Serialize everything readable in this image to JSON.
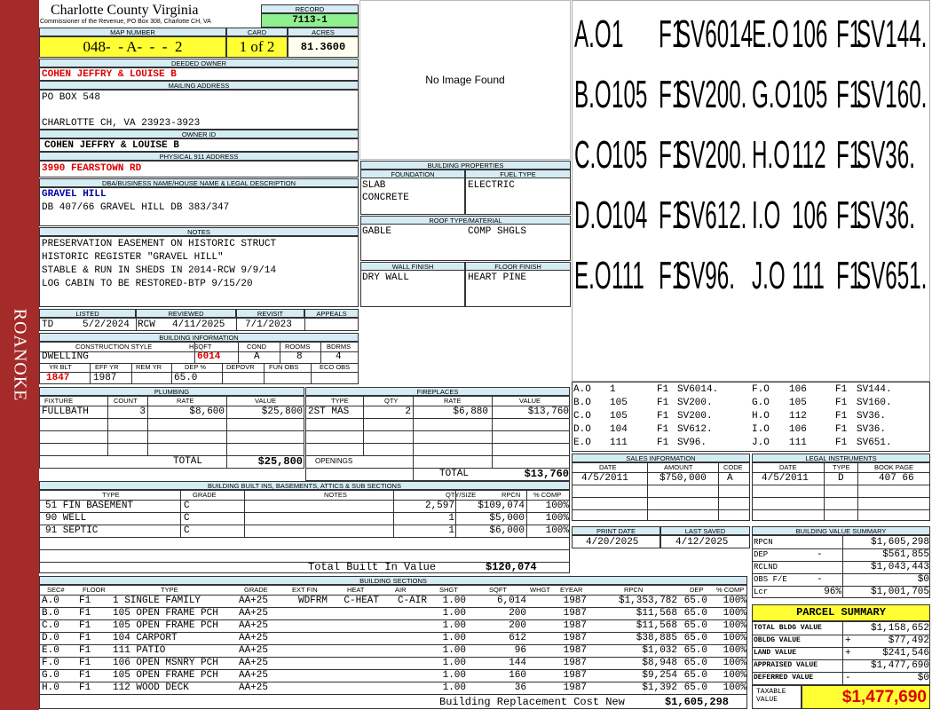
{
  "side_label": "ROANOKE",
  "county": {
    "title": "Charlotte County Virginia",
    "subtitle": "Commissioner of the Revenue, PO Box 308, Charlotte CH, VA"
  },
  "record": {
    "label": "RECORD",
    "value": "7113-1"
  },
  "map": {
    "label": "MAP NUMBER",
    "value": "048-  - A-  -  -  2"
  },
  "card": {
    "label": "CARD",
    "value": "1 of 2"
  },
  "acres": {
    "label": "ACRES",
    "value": "81.3600"
  },
  "deeded_owner": {
    "label": "DEEDED OWNER",
    "value": "COHEN JEFFRY & LOUISE B"
  },
  "mailing": {
    "label": "MAILING ADDRESS",
    "line1": "PO BOX 548",
    "line2": "CHARLOTTE CH, VA 23923-3923"
  },
  "owner_id": {
    "label": "OWNER ID",
    "value": "COHEN JEFFRY & LOUISE B"
  },
  "physical": {
    "label": "PHYSICAL 911 ADDRESS",
    "value": "3990 FEARSTOWN RD"
  },
  "dba": {
    "label": "DBA/BUSINESS NAME/HOUSE NAME & LEGAL DESCRIPTION",
    "name": "GRAVEL HILL",
    "desc": "DB 407/66 GRAVEL HILL DB 383/347"
  },
  "notes": {
    "label": "NOTES",
    "lines": [
      "PRESERVATION EASEMENT ON HISTORIC STRUCT",
      "HISTORIC REGISTER \"GRAVEL HILL\"",
      "STABLE & RUN IN SHEDS IN 2014-RCW 9/9/14",
      "LOG CABIN TO BE RESTORED-BTP 9/15/20"
    ]
  },
  "image": {
    "text": "No Image Found"
  },
  "building_props": {
    "label": "BUILDING PROPERTIES",
    "foundation_label": "FOUNDATION",
    "foundation": [
      "SLAB",
      "CONCRETE"
    ],
    "fuel_label": "FUEL TYPE",
    "fuel": "ELECTRIC",
    "roof_label": "ROOF TYPE/MATERIAL",
    "roof_type": "GABLE",
    "roof_material": "COMP SHGLS",
    "wall_label": "WALL FINISH",
    "wall": "DRY WALL",
    "floor_label": "FLOOR FINISH",
    "floor": "HEART PINE"
  },
  "listed": {
    "label": "LISTED",
    "by": "TD",
    "date": "5/2/2024"
  },
  "reviewed": {
    "label": "REVIEWED",
    "by": "RCW",
    "date": "4/11/2025"
  },
  "revisit": {
    "label": "REVISIT",
    "date": "7/1/2023"
  },
  "appeals": {
    "label": "APPEALS"
  },
  "building_info": {
    "label": "BUILDING INFORMATION",
    "style_label": "CONSTRUCTION STYLE",
    "style": "DWELLING",
    "hsqft_label": "HSQFT",
    "hsqft": "6014",
    "cond_label": "COND",
    "cond": "A",
    "rooms_label": "ROOMS",
    "rooms": "8",
    "bdrms_label": "BDRMS",
    "bdrms": "4",
    "yrblt_label": "YR BLT",
    "yrblt": "1847",
    "effyr_label": "EFF YR",
    "effyr": "1987",
    "remyr_label": "REM YR",
    "dep_label": "DEP %",
    "dep": "65.0",
    "depovr_label": "DEPOVR",
    "funobs_label": "FUN OBS",
    "ecoobs_label": "ECO OBS"
  },
  "plumbing": {
    "label": "PLUMBING",
    "headers": [
      "FIXTURE",
      "COUNT",
      "RATE",
      "VALUE"
    ],
    "rows": [
      [
        "FULLBATH",
        "3",
        "$8,600",
        "$25,800"
      ]
    ],
    "total_label": "TOTAL",
    "total": "$25,800"
  },
  "fireplaces": {
    "label": "FIREPLACES",
    "headers": [
      "TYPE",
      "QTY",
      "RATE",
      "VALUE"
    ],
    "rows": [
      [
        "2ST MAS",
        "2",
        "$6,880",
        "$13,760"
      ]
    ],
    "openings_label": "OPENINGS",
    "total_label": "TOTAL",
    "total": "$13,760"
  },
  "sketch": {
    "big": [
      [
        "A.O",
        "1",
        "F1",
        "SV6014.",
        "E.O",
        "106",
        "F1",
        "SV144."
      ],
      [
        "B.O",
        "105",
        "F1",
        "SV200.",
        "G.O",
        "105",
        "F1",
        "SV160."
      ],
      [
        "C.O",
        "105",
        "F1",
        "SV200.",
        "H.O",
        "112",
        "F1",
        "SV36."
      ],
      [
        "D.O",
        "104",
        "F1",
        "SV612.",
        "I.O",
        "106",
        "F1",
        "SV36."
      ],
      [
        "E.O",
        "111",
        "F1",
        "SV96.",
        "J.O",
        "111",
        "F1",
        "SV651."
      ]
    ],
    "small": [
      [
        "A.O",
        "1",
        "F1",
        "SV6014.",
        "F.O",
        "106",
        "F1",
        "SV144."
      ],
      [
        "B.O",
        "105",
        "F1",
        "SV200.",
        "G.O",
        "105",
        "F1",
        "SV160."
      ],
      [
        "C.O",
        "105",
        "F1",
        "SV200.",
        "H.O",
        "112",
        "F1",
        "SV36."
      ],
      [
        "D.O",
        "104",
        "F1",
        "SV612.",
        "I.O",
        "106",
        "F1",
        "SV36."
      ],
      [
        "E.O",
        "111",
        "F1",
        "SV96.",
        "J.O",
        "111",
        "F1",
        "SV651."
      ]
    ]
  },
  "sales": {
    "label": "SALES INFORMATION",
    "headers": [
      "DATE",
      "AMOUNT",
      "CODE"
    ],
    "rows": [
      [
        "4/5/2011",
        "$750,000",
        "A"
      ]
    ]
  },
  "legal": {
    "label": "LEGAL INSTRUMENTS",
    "headers": [
      "DATE",
      "TYPE",
      "BOOK PAGE"
    ],
    "rows": [
      [
        "4/5/2011",
        "D",
        "407 66"
      ]
    ]
  },
  "print_date": {
    "label": "PRINT DATE",
    "value": "4/20/2025"
  },
  "last_saved": {
    "label": "LAST SAVED",
    "value": "4/12/2025"
  },
  "builtins": {
    "label": "BUILDING BUILT INS, BASEMENTS, ATTICS & SUB SECTIONS",
    "headers": [
      "TYPE",
      "GRADE",
      "NOTES",
      "QTY/SIZE",
      "RPCN",
      "% COMP"
    ],
    "rows": [
      [
        "51 FIN BASEMENT",
        "C",
        "",
        "2,597",
        "$109,074",
        "100%"
      ],
      [
        "90 WELL",
        "C",
        "",
        "1",
        "$5,000",
        "100%"
      ],
      [
        "91 SEPTIC",
        "C",
        "",
        "1",
        "$6,000",
        "100%"
      ]
    ],
    "total_label": "Total Built In Value",
    "total": "$120,074"
  },
  "value_summary": {
    "label": "BUILDING VALUE SUMMARY",
    "rows": [
      [
        "RPCN",
        "",
        "$1,605,298"
      ],
      [
        "DEP",
        "-",
        "$561,855"
      ],
      [
        "RCLND",
        "",
        "$1,043,443"
      ],
      [
        "OBS F/E",
        "-",
        "$0"
      ],
      [
        "Lcr",
        "96%",
        "$1,001,705"
      ]
    ]
  },
  "parcel_summary": {
    "label": "PARCEL SUMMARY",
    "rows": [
      [
        "TOTAL BLDG VALUE",
        "",
        "$1,158,652"
      ],
      [
        "OBLDG VALUE",
        "+",
        "$77,492"
      ],
      [
        "LAND VALUE",
        "+",
        "$241,546"
      ],
      [
        "APPRAISED VALUE",
        "",
        "$1,477,690"
      ],
      [
        "DEFERRED VALUE",
        "-",
        "$0"
      ]
    ],
    "taxable_label": "TAXABLE VALUE",
    "taxable": "$1,477,690"
  },
  "sections": {
    "label": "BUILDING SECTIONS",
    "headers": [
      "SEC#",
      "FLOOR",
      "TYPE",
      "GRADE",
      "EXT FIN",
      "HEAT",
      "AIR",
      "SHGT",
      "SQFT",
      "WHGT",
      "EYEAR",
      "RPCN",
      "DEP",
      "% COMP"
    ],
    "rows": [
      [
        "A.0",
        "F1",
        "1 SINGLE FAMILY",
        "AA+25",
        "WDFRM",
        "C-HEAT",
        "C-AIR",
        "1.00",
        "6,014",
        "",
        "1987",
        "$1,353,782",
        "65.0",
        "100%"
      ],
      [
        "B.0",
        "F1",
        "105 OPEN FRAME PCH",
        "AA+25",
        "",
        "",
        "",
        "1.00",
        "200",
        "",
        "1987",
        "$11,568",
        "65.0",
        "100%"
      ],
      [
        "C.0",
        "F1",
        "105 OPEN FRAME PCH",
        "AA+25",
        "",
        "",
        "",
        "1.00",
        "200",
        "",
        "1987",
        "$11,568",
        "65.0",
        "100%"
      ],
      [
        "D.0",
        "F1",
        "104 CARPORT",
        "AA+25",
        "",
        "",
        "",
        "1.00",
        "612",
        "",
        "1987",
        "$38,885",
        "65.0",
        "100%"
      ],
      [
        "E.0",
        "F1",
        "111 PATIO",
        "AA+25",
        "",
        "",
        "",
        "1.00",
        "96",
        "",
        "1987",
        "$1,032",
        "65.0",
        "100%"
      ],
      [
        "F.0",
        "F1",
        "106 OPEN MSNRY PCH",
        "AA+25",
        "",
        "",
        "",
        "1.00",
        "144",
        "",
        "1987",
        "$8,948",
        "65.0",
        "100%"
      ],
      [
        "G.0",
        "F1",
        "105 OPEN FRAME PCH",
        "AA+25",
        "",
        "",
        "",
        "1.00",
        "160",
        "",
        "1987",
        "$9,254",
        "65.0",
        "100%"
      ],
      [
        "H.0",
        "F1",
        "112 WOOD DECK",
        "AA+25",
        "",
        "",
        "",
        "1.00",
        "36",
        "",
        "1987",
        "$1,392",
        "65.0",
        "100%"
      ]
    ],
    "total_label": "Building Replacement Cost New",
    "total": "$1,605,298"
  }
}
